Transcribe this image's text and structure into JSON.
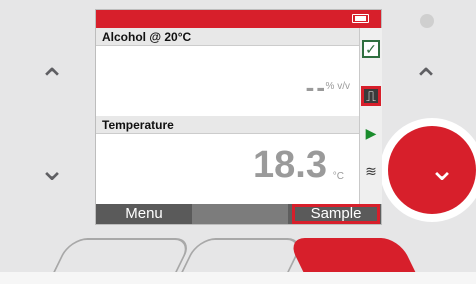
{
  "screen": {
    "battery_icon": "battery-icon",
    "sections": [
      {
        "title": "Alcohol @ 20°C",
        "value": "--",
        "unit": "% v/v"
      },
      {
        "title": "Temperature",
        "value": "18.3",
        "unit": "°C"
      }
    ],
    "side_icons": [
      {
        "name": "checkmark-icon",
        "glyph": "✓"
      },
      {
        "name": "pump-icon",
        "glyph": "⎍"
      },
      {
        "name": "play-icon",
        "glyph": "▶"
      },
      {
        "name": "layers-icon",
        "glyph": "≋"
      }
    ],
    "buttons": {
      "menu": "Menu",
      "blank": "",
      "sample": "Sample"
    }
  },
  "device": {
    "left_up": "⌃",
    "left_down": "⌄",
    "right_up": "⌃",
    "right_down": "⌄"
  },
  "colors": {
    "accent": "#d71f2b",
    "screen": "#ffffff",
    "bezel": "#d9d9da"
  }
}
